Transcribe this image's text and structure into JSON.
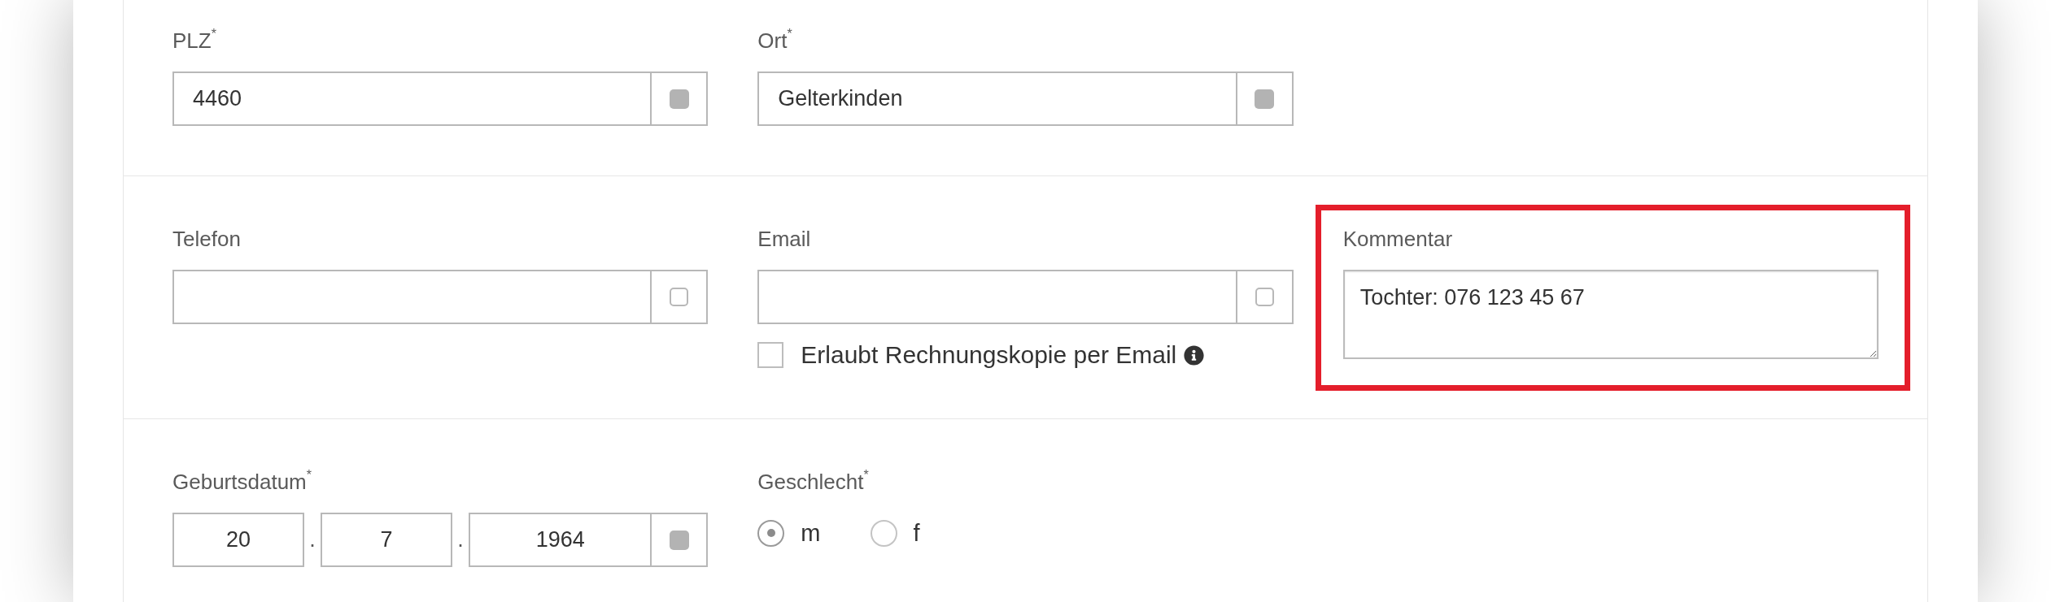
{
  "sections": [
    {
      "fields": [
        {
          "kind": "text",
          "label": "PLZ$^{*}$",
          "value": "4460",
          "addon": {
            "checked": true
          }
        },
        {
          "kind": "text",
          "label": "Ort$^{*}$",
          "value": "Gelterkinden",
          "addon": {
            "checked": true
          }
        }
      ]
    },
    {
      "fields": [
        {
          "kind": "text",
          "label": "Telefon",
          "addon": {
            "checked": false
          }
        },
        {
          "kind": "text",
          "label": "Email",
          "addon": {
            "checked": false
          },
          "option": {
            "label": "Erlaubt Rechnungskopie per Email",
            "checked": false
          }
        },
        {
          "kind": "textarea",
          "label": "Kommentar",
          "value": "Tochter: 076 123 45 67",
          "highlighted": true
        }
      ]
    },
    {
      "fields": [
        {
          "kind": "date",
          "label": "Geburtsdatum$^{*}$",
          "parts": [
            {
              "kind": "input",
              "value": "20"
            },
            {
              "kind": "separator",
              "text": "."
            },
            {
              "kind": "input",
              "value": "7"
            },
            {
              "kind": "separator",
              "text": "."
            },
            {
              "kind": "input",
              "value": "1964"
            }
          ],
          "addon": {
            "checked": true
          }
        },
        {
          "kind": "radio",
          "label": "Geschlecht$^{*}$",
          "options": [
            {
              "label": "m",
              "selected": true
            },
            {
              "label": "f",
              "selected": false
            }
          ]
        }
      ]
    }
  ]
}
